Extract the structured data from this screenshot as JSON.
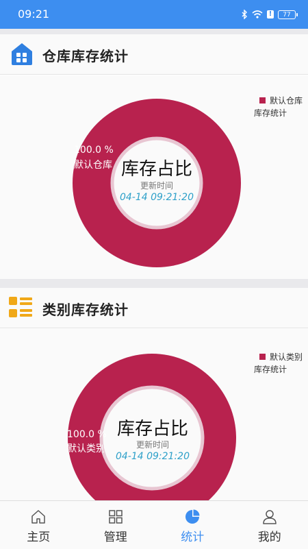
{
  "status_bar": {
    "time": "09:21",
    "battery": "77"
  },
  "warehouse_card": {
    "title": "仓库库存统计",
    "legend_name": "默认仓库",
    "legend_sub": "库存统计",
    "center_title": "库存占比",
    "updated_label": "更新时间",
    "updated_time": "04-14 09:21:20",
    "slice_percent": "100.0 %",
    "slice_name": "默认仓库"
  },
  "category_card": {
    "title": "类别库存统计",
    "legend_name": "默认类别",
    "legend_sub": "库存统计",
    "center_title": "库存占比",
    "updated_label": "更新时间",
    "updated_time": "04-14 09:21:20",
    "slice_percent": "100.0 %",
    "slice_name": "默认类别"
  },
  "chart_data": [
    {
      "type": "pie",
      "title": "库存占比",
      "categories": [
        "默认仓库"
      ],
      "values": [
        100.0
      ],
      "legend": "top-right"
    },
    {
      "type": "pie",
      "title": "库存占比",
      "categories": [
        "默认类别"
      ],
      "values": [
        100.0
      ],
      "legend": "top-right"
    }
  ],
  "colors": {
    "accent": "#3d8ef0",
    "slice": "#b8224e",
    "time": "#2ea0c9"
  },
  "bottom_nav": {
    "items": [
      {
        "label": "主页",
        "icon": "home-icon"
      },
      {
        "label": "管理",
        "icon": "grid-icon"
      },
      {
        "label": "统计",
        "icon": "pie-chart-icon"
      },
      {
        "label": "我的",
        "icon": "user-icon"
      }
    ],
    "active": 2
  }
}
